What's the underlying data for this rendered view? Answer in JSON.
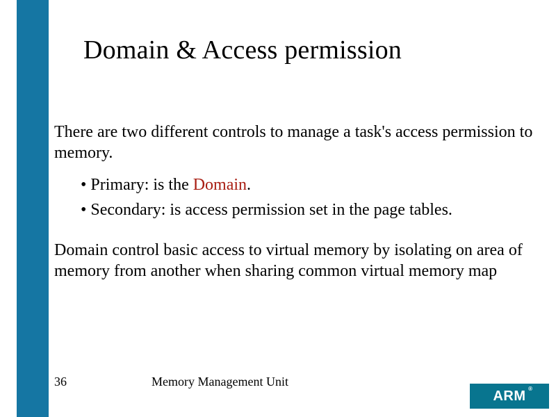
{
  "title": "Domain & Access permission",
  "intro": "There are two different controls to manage a task's access permission to memory.",
  "bullets": [
    {
      "prefix": "• Primary: is the ",
      "red": "Domain",
      "suffix": "."
    },
    {
      "prefix": "• Secondary: is access permission set in the page tables.",
      "red": "",
      "suffix": ""
    }
  ],
  "para2": "Domain control basic access to virtual memory by isolating on area of memory from another when sharing common virtual memory map",
  "footer": {
    "page_number": "36",
    "doc_title": "Memory Management Unit"
  },
  "logo": {
    "text": "ARM",
    "registered": "®"
  }
}
